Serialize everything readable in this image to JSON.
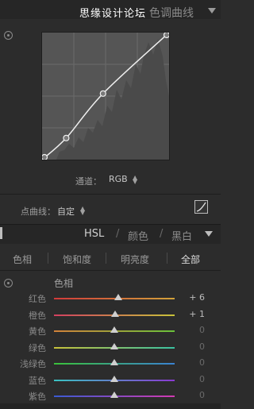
{
  "tone_curve": {
    "watermark": "思缘设计论坛",
    "title": "色调曲线",
    "channel_label": "通道：",
    "channel_value": "RGB",
    "point_curve_label": "点曲线：",
    "point_curve_value": "自定",
    "curve_points": [
      {
        "input": 0,
        "output": 0
      },
      {
        "input": 19,
        "output": 17
      },
      {
        "input": 48,
        "output": 52
      },
      {
        "input": 100,
        "output": 100
      }
    ]
  },
  "hsl": {
    "tabs": [
      "HSL",
      "/",
      "颜色",
      "/",
      "黑白"
    ],
    "subtabs": [
      "色相",
      "饱和度",
      "明亮度",
      "全部"
    ],
    "active_subtab": "全部",
    "section_title": "色相",
    "slider_range": [
      -100,
      100
    ],
    "rows": [
      {
        "label": "红色",
        "value": 6,
        "display": "+ 6",
        "colors": [
          "#d23a3a",
          "#d2a23a"
        ]
      },
      {
        "label": "橙色",
        "value": 1,
        "display": "+ 1",
        "colors": [
          "#d24060",
          "#c8c23a"
        ]
      },
      {
        "label": "黄色",
        "value": 0,
        "display": "0",
        "colors": [
          "#d2823a",
          "#6ac23a"
        ]
      },
      {
        "label": "绿色",
        "value": 0,
        "display": "0",
        "colors": [
          "#c8c23a",
          "#3ac2a2"
        ]
      },
      {
        "label": "浅绿色",
        "value": 0,
        "display": "0",
        "colors": [
          "#3ac23a",
          "#3a82d2"
        ]
      },
      {
        "label": "蓝色",
        "value": 0,
        "display": "0",
        "colors": [
          "#3ac2c2",
          "#8a3ad2"
        ]
      },
      {
        "label": "紫色",
        "value": 0,
        "display": "0",
        "colors": [
          "#3a5ad2",
          "#d23ab2"
        ]
      }
    ]
  }
}
